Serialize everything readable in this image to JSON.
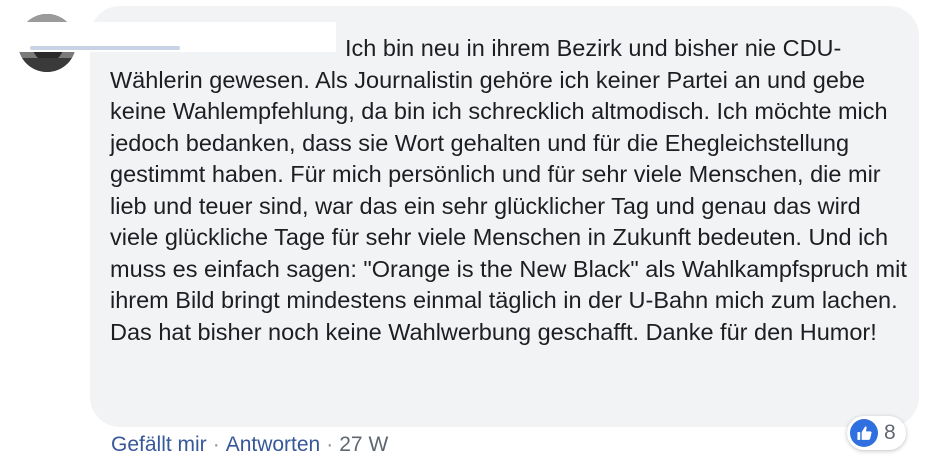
{
  "comment": {
    "text": "Ich bin neu in ihrem Bezirk und bisher nie CDU-Wählerin gewesen. Als Journalistin gehöre ich keiner Partei an und gebe keine Wahlempfehlung, da bin ich schrecklich altmodisch. Ich möchte mich jedoch bedanken, dass sie Wort gehalten und für die Ehegleichstellung gestimmt haben. Für mich persönlich und für sehr viele Menschen, die mir lieb und teuer sind, war das ein sehr glücklicher Tag und genau das wird viele glückliche Tage für sehr viele Menschen in Zukunft bedeuten. Und ich muss es einfach sagen: \"Orange is the New Black\" als Wahlkampfspruch mit ihrem Bild bringt mindestens einmal täglich in der U-Bahn mich zum lachen. Das hat bisher noch keine Wahlwerbung geschafft. Danke für den Humor!",
    "author_redacted": true
  },
  "reactions": {
    "icon": "like-icon",
    "count": "8",
    "accent": "#2f6fe0"
  },
  "actions": {
    "like_label": "Gefällt mir",
    "separator": "·",
    "reply_label": "Antworten",
    "timestamp": "27 W"
  },
  "colors": {
    "bubble": "#f2f3f5",
    "text": "#1c1e21",
    "link": "#365899",
    "meta": "#606770"
  }
}
